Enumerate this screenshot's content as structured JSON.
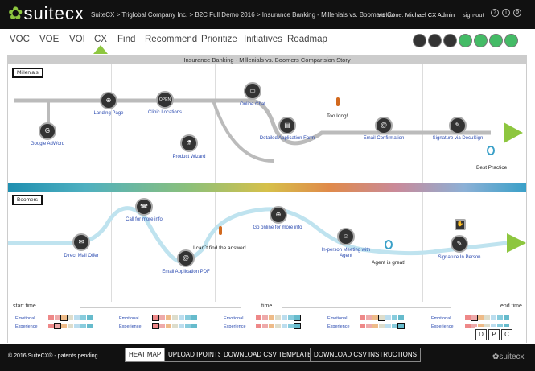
{
  "header": {
    "logo": "suitecx",
    "breadcrumb": "SuiteCX > Triglobal Company Inc. > B2C Full Demo 2016 > Insurance Banking - Millenials vs. Boomers Co",
    "welcome_prefix": "welcome:",
    "user": "Michael CX Admin",
    "signout": "sign-out"
  },
  "nav": {
    "tabs": [
      "VOC",
      "VOE",
      "VOI",
      "CX",
      "Find",
      "Recommend",
      "Prioritize",
      "Initiatives",
      "Roadmap"
    ],
    "active": "CX"
  },
  "panel": {
    "title": "Insurance Banking - Millenials vs. Boomers Comparision Story",
    "millenials": {
      "label": "Millenials",
      "steps": [
        "Google AdWord",
        "Landing Page",
        "Clinic Locations",
        "Product Wizard",
        "Online Chat",
        "Detailed Application Form",
        "Email Confirmation",
        "Signature via DocuSign"
      ],
      "notes": [
        "Too long!",
        "Best Practice"
      ]
    },
    "boomers": {
      "label": "Boomers",
      "steps": [
        "Direct Mail Offer",
        "Call for more info",
        "Email Application PDF",
        "Go online for more info",
        "In-person Meeting with Agent",
        "Signature In Person"
      ],
      "notes": [
        "I can`t find the answer!",
        "Agent is great!"
      ]
    },
    "timeline": {
      "start": "start time",
      "middle": "time",
      "end": "end time",
      "row_emotional": "Emotional",
      "row_experience": "Experience"
    }
  },
  "dpc": [
    "D",
    "P",
    "C"
  ],
  "footer": {
    "copyright": "© 2016 SuiteCX® - patents pending",
    "buttons": [
      "HEAT MAP",
      "UPLOAD IPOINTS",
      "DOWNLOAD CSV TEMPLATE",
      "DOWNLOAD CSV INSTRUCTIONS"
    ],
    "logo": "suitecx"
  },
  "colors": {
    "accent": "#8dc63f",
    "link": "#2a4ab0",
    "dark": "#111111"
  }
}
